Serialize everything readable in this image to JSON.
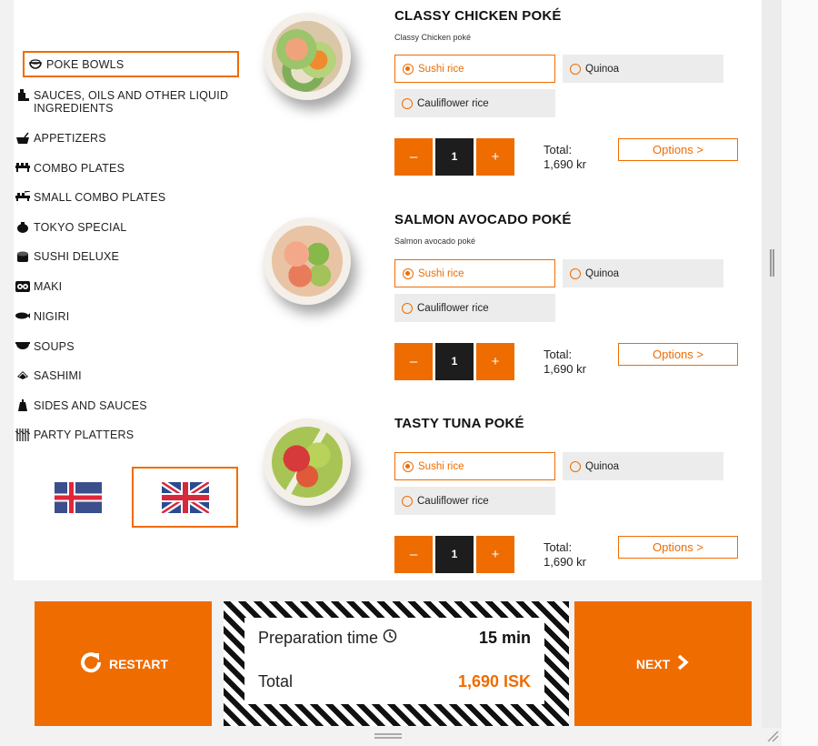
{
  "sidebar": {
    "items": [
      {
        "label": "POKE BOWLS",
        "icon": "bowl-icon"
      },
      {
        "label": "SAUCES, OILS AND OTHER LIQUID INGREDIENTS",
        "icon": "bottle-icon"
      },
      {
        "label": "APPETIZERS",
        "icon": "appetizer-icon"
      },
      {
        "label": "COMBO PLATES",
        "icon": "combo-plate-icon"
      },
      {
        "label": "SMALL COMBO PLATES",
        "icon": "small-combo-icon"
      },
      {
        "label": "TOKYO SPECIAL",
        "icon": "tokyo-icon"
      },
      {
        "label": "SUSHI DELUXE",
        "icon": "sushi-icon"
      },
      {
        "label": "MAKI",
        "icon": "maki-icon"
      },
      {
        "label": "NIGIRI",
        "icon": "nigiri-icon"
      },
      {
        "label": "SOUPS",
        "icon": "soup-icon"
      },
      {
        "label": "SASHIMI",
        "icon": "sashimi-icon"
      },
      {
        "label": "SIDES AND SAUCES",
        "icon": "sauce-icon"
      },
      {
        "label": "PARTY PLATTERS",
        "icon": "party-platter-icon"
      }
    ],
    "languages": [
      "icelandic-flag",
      "english-flag"
    ],
    "selected_language": "english-flag"
  },
  "products": [
    {
      "title": "CLASSY CHICKEN POKÉ",
      "subtitle": "Classy Chicken poké",
      "options": [
        "Sushi rice",
        "Quinoa",
        "Cauliflower rice"
      ],
      "selected_option": "Sushi rice",
      "minus": "–",
      "quantity": "1",
      "plus": "+",
      "total_label": "Total:",
      "total_value": "1,690 kr",
      "options_button": "Options >"
    },
    {
      "title": "SALMON AVOCADO POKÉ",
      "subtitle": "Salmon avocado poké",
      "options": [
        "Sushi rice",
        "Quinoa",
        "Cauliflower rice"
      ],
      "selected_option": "Sushi rice",
      "minus": "–",
      "quantity": "1",
      "plus": "+",
      "total_label": "Total:",
      "total_value": "1,690 kr",
      "options_button": "Options >"
    },
    {
      "title": "TASTY TUNA POKÉ",
      "subtitle": "",
      "options": [
        "Sushi rice",
        "Quinoa",
        "Cauliflower rice"
      ],
      "selected_option": "Sushi rice",
      "minus": "–",
      "quantity": "1",
      "plus": "+",
      "total_label": "Total:",
      "total_value": "1,690 kr",
      "options_button": "Options >"
    }
  ],
  "footer": {
    "restart_label": "RESTART",
    "prep_label": "Preparation time",
    "prep_value": "15 min",
    "total_label": "Total",
    "total_value": "1,690 ISK",
    "next_label": "NEXT"
  },
  "colors": {
    "accent": "#ef6c00",
    "dark": "#1d1d1d",
    "option_bg": "#ececec"
  }
}
